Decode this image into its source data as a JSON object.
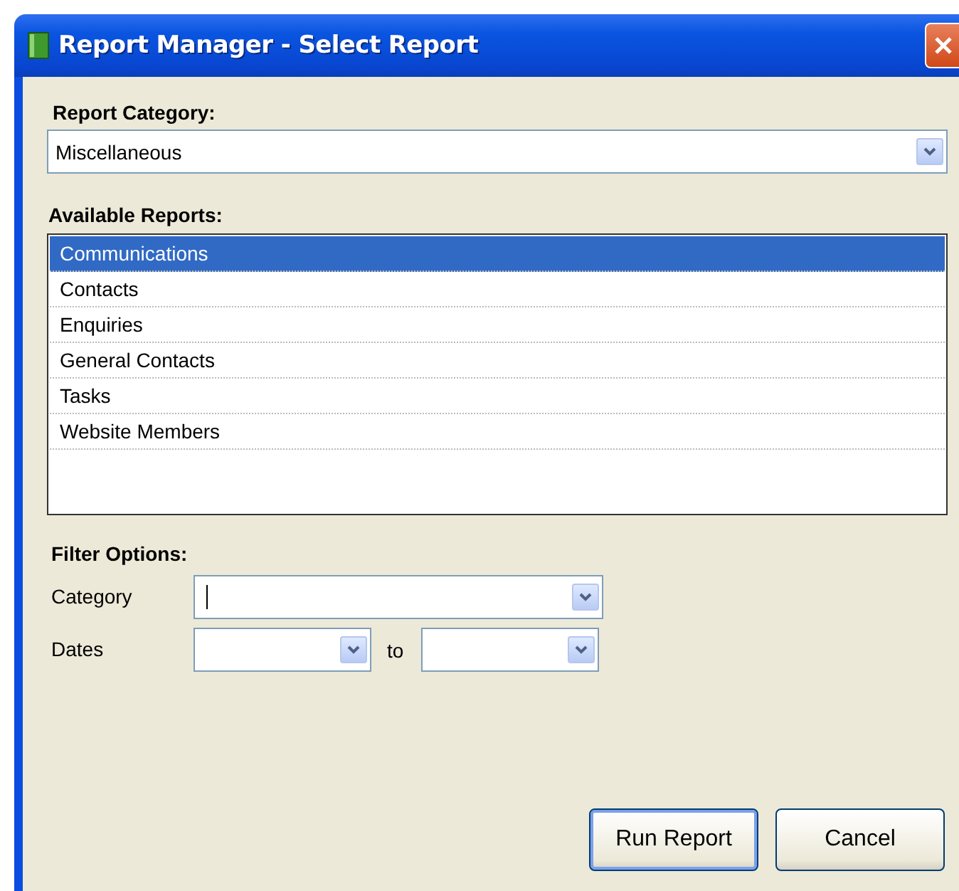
{
  "window": {
    "title": "Report Manager - Select Report"
  },
  "report_category": {
    "label": "Report Category:",
    "value": "Miscellaneous"
  },
  "available_reports": {
    "label": "Available Reports:",
    "items": [
      {
        "label": "Communications",
        "selected": true
      },
      {
        "label": "Contacts",
        "selected": false
      },
      {
        "label": "Enquiries",
        "selected": false
      },
      {
        "label": "General Contacts",
        "selected": false
      },
      {
        "label": "Tasks",
        "selected": false
      },
      {
        "label": "Website Members",
        "selected": false
      }
    ]
  },
  "filter_options": {
    "label": "Filter Options:",
    "category": {
      "label": "Category",
      "focused": true
    },
    "dates": {
      "label": "Dates",
      "separator": "to"
    }
  },
  "buttons": [
    {
      "label": "Run Report",
      "default": true
    },
    {
      "label": "Cancel",
      "default": false
    }
  ]
}
